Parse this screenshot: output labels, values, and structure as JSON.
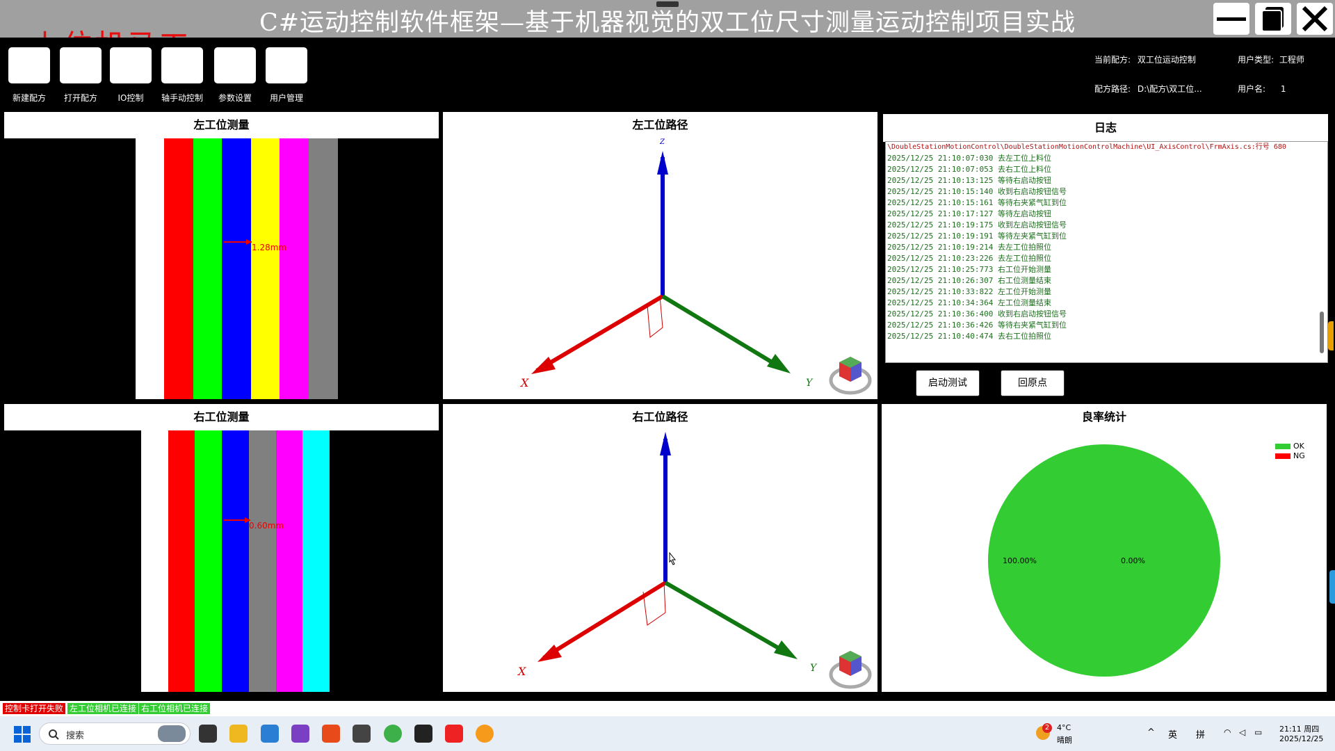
{
  "title": "C#运动控制软件框架—基于机器视觉的双工位尺寸测量运动控制项目实战",
  "watermark": "上位机马工",
  "toolbar": {
    "items": [
      {
        "label": "新建配方"
      },
      {
        "label": "打开配方"
      },
      {
        "label": "IO控制"
      },
      {
        "label": "轴手动控制"
      },
      {
        "label": "参数设置"
      },
      {
        "label": "用户管理"
      }
    ]
  },
  "info": {
    "recipe_label": "当前配方:",
    "recipe_value": "双工位运动控制",
    "user_type_label": "用户类型:",
    "user_type_value": "工程师",
    "path_label": "配方路径:",
    "path_value": "D:\\配方\\双工位...",
    "user_name_label": "用户名:",
    "user_name_value": "1"
  },
  "panels": {
    "left_measure": "左工位测量",
    "left_path": "左工位路径",
    "log": "日志",
    "right_measure": "右工位测量",
    "right_path": "右工位路径",
    "yield": "良率统计"
  },
  "measurements": {
    "left": "1.28mm",
    "right": "0.60mm"
  },
  "stripes": {
    "left": [
      "#ffffff",
      "#ff0000",
      "#00ff00",
      "#0000ff",
      "#ffff00",
      "#ff00ff",
      "#808080"
    ],
    "right": [
      "#ffffff",
      "#ff0000",
      "#00ff00",
      "#0000ff",
      "#808080",
      "#ff00ff",
      "#00ffff"
    ]
  },
  "axis_labels": {
    "x": "X",
    "y": "Y",
    "z": "Z"
  },
  "log": {
    "lines": [
      "\\DoubleStationMotionControl\\DoubleStationMotionControlMachine\\UI_AxisControl\\FrmAxis.cs:行号 680",
      "2025/12/25 21:10:07:030 去左工位上料位",
      "2025/12/25 21:10:07:053 去右工位上料位",
      "2025/12/25 21:10:13:125 等待右启动按钮",
      "2025/12/25 21:10:15:140 收到右启动按钮信号",
      "2025/12/25 21:10:15:161 等待右夹紧气缸到位",
      "2025/12/25 21:10:17:127 等待左启动按钮",
      "2025/12/25 21:10:19:175 收到左启动按钮信号",
      "2025/12/25 21:10:19:191 等待左夹紧气缸到位",
      "2025/12/25 21:10:19:214 去左工位拍照位",
      "2025/12/25 21:10:23:226 去左工位拍照位",
      "2025/12/25 21:10:25:773 右工位开始测量",
      "2025/12/25 21:10:26:307 右工位测量结束",
      "2025/12/25 21:10:33:822 左工位开始测量",
      "2025/12/25 21:10:34:364 左工位测量结束",
      "2025/12/25 21:10:36:400 收到右启动按钮信号",
      "2025/12/25 21:10:36:426 等待右夹紧气缸到位",
      "2025/12/25 21:10:40:474 去右工位拍照位"
    ]
  },
  "buttons": {
    "start_test": "启动测试",
    "home": "回原点"
  },
  "yield_stats": {
    "legend": [
      {
        "name": "OK",
        "color": "#33cc33"
      },
      {
        "name": "NG",
        "color": "#ff0000"
      }
    ],
    "ok_label": "100.00%",
    "ng_label": "0.00%"
  },
  "chart_data": {
    "type": "pie",
    "title": "良率统计",
    "categories": [
      "OK",
      "NG"
    ],
    "values": [
      100.0,
      0.0
    ],
    "labels": [
      "100.00%",
      "0.00%"
    ],
    "colors": [
      "#33cc33",
      "#ff0000"
    ],
    "legend": "top-right"
  },
  "status": [
    {
      "text": "控制卡打开失败",
      "color": "#e00000"
    },
    {
      "text": "左工位相机已连接",
      "color": "#33cc33"
    },
    {
      "text": "右工位相机已连接",
      "color": "#33cc33"
    }
  ],
  "taskbar": {
    "search_placeholder": "搜索",
    "weather_temp": "4°C",
    "weather_desc": "晴朗",
    "weather_badge": "2",
    "ime_lang": "英",
    "ime_mode": "拼",
    "time": "21:11 周四",
    "date": "2025/12/25"
  }
}
